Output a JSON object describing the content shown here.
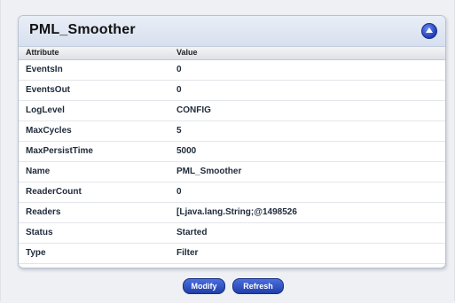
{
  "panel": {
    "title": "PML_Smoother"
  },
  "table": {
    "headers": {
      "attribute": "Attribute",
      "value": "Value"
    },
    "rows": [
      {
        "attribute": "EventsIn",
        "value": "0"
      },
      {
        "attribute": "EventsOut",
        "value": "0"
      },
      {
        "attribute": "LogLevel",
        "value": "CONFIG"
      },
      {
        "attribute": "MaxCycles",
        "value": "5"
      },
      {
        "attribute": "MaxPersistTime",
        "value": "5000"
      },
      {
        "attribute": "Name",
        "value": "PML_Smoother"
      },
      {
        "attribute": "ReaderCount",
        "value": "0"
      },
      {
        "attribute": "Readers",
        "value": "[Ljava.lang.String;@1498526"
      },
      {
        "attribute": "Status",
        "value": "Started"
      },
      {
        "attribute": "Type",
        "value": "Filter"
      }
    ]
  },
  "actions": {
    "modify_label": "Modify",
    "refresh_label": "Refresh"
  },
  "icons": {
    "collapse": "chevron-up-circle-icon"
  },
  "colors": {
    "accent": "#1f3ea8",
    "header_bg": "#d7e0ef"
  }
}
